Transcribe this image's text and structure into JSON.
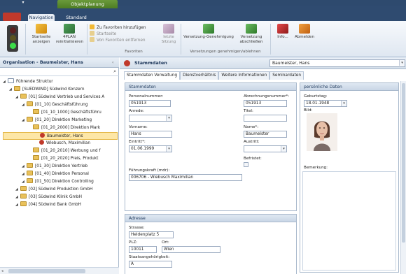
{
  "ribbon": {
    "context_tab": "Objektplanung",
    "tabs": [
      "Navigation",
      "Standard"
    ],
    "buttons": {
      "startseite": "Startseite anzeigen",
      "fourplan": "4PLAN reinitialisieren",
      "fav_add": "Zu Favoriten hinzufügen",
      "fav_start": "Startseite",
      "fav_remove": "Von Favoriten entfernen",
      "last_session": "letzte Sitzung",
      "versetzung_gen": "Versetzung-Genehmigung",
      "versetzung_abs": "Versetzung abschließen",
      "info": "Info...",
      "abmelden": "Abmelden"
    },
    "groups": {
      "favoriten": "Favoriten",
      "versetzungen": "Versetzungen genehmigen/ablehnen"
    }
  },
  "left": {
    "title": "Organisation - Baumeister, Hans",
    "tree": [
      {
        "label": "Führende Struktur",
        "indent": 0,
        "type": "root"
      },
      {
        "label": "[SUEDWIND] Südwind Konzern",
        "indent": 1,
        "type": "folder"
      },
      {
        "label": "[01] Südwind Vertrieb und Services A",
        "indent": 2,
        "type": "folder"
      },
      {
        "label": "[01_10] Geschäftsführung",
        "indent": 3,
        "type": "folder"
      },
      {
        "label": "[01_10_1000] Geschäftsführu",
        "indent": 4,
        "type": "folder"
      },
      {
        "label": "[01_20] Direktion Marketing",
        "indent": 3,
        "type": "folder"
      },
      {
        "label": "[01_20_2000] Direktion Mark",
        "indent": 4,
        "type": "folder"
      },
      {
        "label": "Baumeister, Hans",
        "indent": 5,
        "type": "person",
        "selected": true
      },
      {
        "label": "Wiebusch, Maximilian",
        "indent": 5,
        "type": "person"
      },
      {
        "label": "[01_20_2010] Werbung und f",
        "indent": 4,
        "type": "folder"
      },
      {
        "label": "[01_20_2020] Preis, Produkt",
        "indent": 4,
        "type": "folder"
      },
      {
        "label": "[01_30] Direktion Vertrieb",
        "indent": 3,
        "type": "folder"
      },
      {
        "label": "[01_40] Direktion Personal",
        "indent": 3,
        "type": "folder"
      },
      {
        "label": "[01_50] Direktion Controlling",
        "indent": 3,
        "type": "folder"
      },
      {
        "label": "[02] Südwind Produktion GmbH",
        "indent": 2,
        "type": "folder"
      },
      {
        "label": "[03] Südwind Klinik GmbH",
        "indent": 2,
        "type": "folder"
      },
      {
        "label": "[04] Südwind Bank GmbH",
        "indent": 2,
        "type": "folder"
      }
    ]
  },
  "main": {
    "title": "Stammdaten",
    "combo_value": "Baumeister, Hans",
    "subtabs": [
      "Stammdaten Verwaltung",
      "Dienstverhältnis",
      "Weitere Informationen",
      "Seminardaten"
    ],
    "stammdaten": {
      "header": "Stammdaten",
      "personalnummer_label": "Personalnummer:",
      "personalnummer": "051913",
      "abrechnungsnummer_label": "Abrechnungsnummer*:",
      "abrechnungsnummer": "051913",
      "anrede_label": "Anrede:",
      "anrede": "",
      "titel_label": "Titel:",
      "titel": "",
      "vorname_label": "Vorname:",
      "vorname": "Hans",
      "name_label": "Name*:",
      "name": "Baumeister",
      "eintritt_label": "Eintritt*:",
      "eintritt": "01.06.1999",
      "austritt_label": "Austritt:",
      "austritt": "",
      "befristet_label": "Befristet:",
      "fuehrungskraft_label": "Führungskraft (mdr):",
      "fuehrungskraft": "006706 - Wiebusch Maximilian"
    },
    "persoenlich": {
      "header": "persönliche Daten",
      "geburtstag_label": "Geburtstag:",
      "geburtstag": "18.01.1948",
      "bild_label": "Bild:",
      "bemerkung_label": "Bemerkung:"
    },
    "adresse": {
      "header": "Adresse",
      "strasse_label": "Strasse:",
      "strasse": "Heldenplatz 5",
      "plz_label": "PLZ:",
      "plz": "10011",
      "ort_label": "Ort:",
      "ort": "Wien",
      "staat_label": "Staatsangehörigkeit:",
      "staat": "A"
    }
  }
}
